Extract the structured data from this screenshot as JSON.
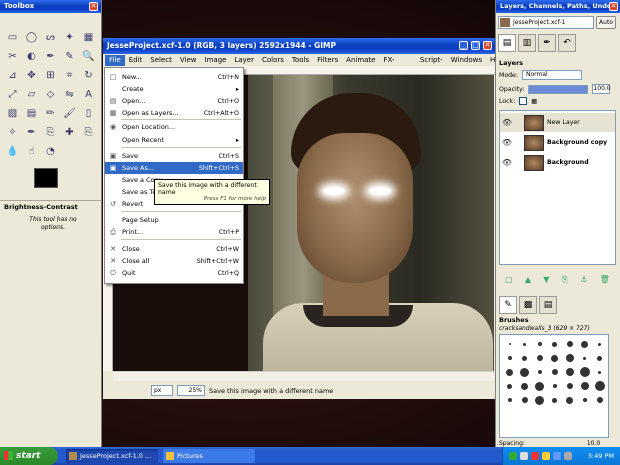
{
  "toolbox": {
    "title": "Toolbox",
    "tools": [
      "rect-select",
      "ellipse-select",
      "free-select",
      "fuzzy-select",
      "select-by-color",
      "scissors",
      "foreground-select",
      "paths",
      "color-picker",
      "zoom",
      "measure",
      "move",
      "align",
      "crop",
      "rotate",
      "scale",
      "shear",
      "perspective",
      "flip",
      "text",
      "bucket-fill",
      "blend",
      "pencil",
      "paintbrush",
      "eraser",
      "airbrush",
      "ink",
      "clone",
      "heal",
      "perspective-clone",
      "blur",
      "smudge",
      "dodge-burn"
    ],
    "tool_icons": [
      "▭",
      "◯",
      "ᔕ",
      "✦",
      "▦",
      "✂",
      "◐",
      "✒",
      "✎",
      "🔍",
      "⊿",
      "✥",
      "⊞",
      "⌗",
      "↻",
      "⤢",
      "▱",
      "◇",
      "⇋",
      "A",
      "▨",
      "▤",
      "✏",
      "🖌",
      "▯",
      "✧",
      "✒",
      "⎘",
      "✚",
      "⎘",
      "💧",
      "☝",
      "◔"
    ],
    "options_title": "Brightness-Contrast",
    "options_note": "This tool has no options."
  },
  "image_window": {
    "title": "JesseProject.xcf-1.0 (RGB, 3 layers) 2592x1944 - GIMP",
    "menus": [
      "File",
      "Edit",
      "Select",
      "View",
      "Image",
      "Layer",
      "Colors",
      "Tools",
      "Filters",
      "Animate",
      "FX-Foundry",
      "Script-Fu",
      "Windows",
      "Help"
    ],
    "active_menu": "File",
    "unit": "px",
    "zoom": "25%",
    "status": "Save this image with a different name"
  },
  "file_menu": {
    "items": [
      {
        "label": "New...",
        "shortcut": "Ctrl+N",
        "icon": "new-icon",
        "glyph": "□"
      },
      {
        "label": "Create",
        "shortcut": "▸",
        "icon": "",
        "glyph": ""
      },
      {
        "label": "Open...",
        "shortcut": "Ctrl+O",
        "icon": "open-icon",
        "glyph": "▤"
      },
      {
        "label": "Open as Layers...",
        "shortcut": "Ctrl+Alt+O",
        "icon": "open-layers-icon",
        "glyph": "▦"
      },
      {
        "label": "Open Location...",
        "shortcut": "",
        "icon": "location-icon",
        "glyph": "◉"
      },
      {
        "label": "Open Recent",
        "shortcut": "▸",
        "icon": "",
        "glyph": ""
      },
      {
        "label": "Save",
        "shortcut": "Ctrl+S",
        "icon": "save-icon",
        "glyph": "▣"
      },
      {
        "label": "Save As...",
        "shortcut": "Shift+Ctrl+S",
        "icon": "save-as-icon",
        "glyph": "▣"
      },
      {
        "label": "Save a Copy...",
        "shortcut": "",
        "icon": "",
        "glyph": ""
      },
      {
        "label": "Save as Template...",
        "shortcut": "",
        "icon": "",
        "glyph": ""
      },
      {
        "label": "Revert",
        "shortcut": "",
        "icon": "revert-icon",
        "glyph": "↺"
      },
      {
        "label": "Page Setup",
        "shortcut": "",
        "icon": "",
        "glyph": ""
      },
      {
        "label": "Print...",
        "shortcut": "Ctrl+P",
        "icon": "print-icon",
        "glyph": "⎙"
      },
      {
        "label": "Close",
        "shortcut": "Ctrl+W",
        "icon": "close-icon",
        "glyph": "✕"
      },
      {
        "label": "Close all",
        "shortcut": "Shift+Ctrl+W",
        "icon": "close-all-icon",
        "glyph": "✕"
      },
      {
        "label": "Quit",
        "shortcut": "Ctrl+Q",
        "icon": "quit-icon",
        "glyph": "⏻"
      }
    ],
    "tooltip": "Save this image with a different name",
    "tooltip_hint": "Press F1 for more help"
  },
  "dock": {
    "title": "Layers, Channels, Paths, Undo - ...",
    "image_select": "JesseProject.xcf-1",
    "auto_label": "Auto",
    "layers_title": "Layers",
    "mode_label": "Mode:",
    "mode_value": "Normal",
    "opacity_label": "Opacity:",
    "opacity_value": "100.0",
    "lock_label": "Lock:",
    "layers": [
      "New Layer",
      "Background copy",
      "Background"
    ],
    "brushes_title": "Brushes",
    "brush_name": "cracksandwalls_3 (629 × 727)",
    "spacing_label": "Spacing:",
    "spacing_value": "10.0"
  },
  "taskbar": {
    "start": "start",
    "tasks": [
      "JesseProject.xcf-1.0 ...",
      "Pictures"
    ],
    "clock": "3:49 PM"
  }
}
